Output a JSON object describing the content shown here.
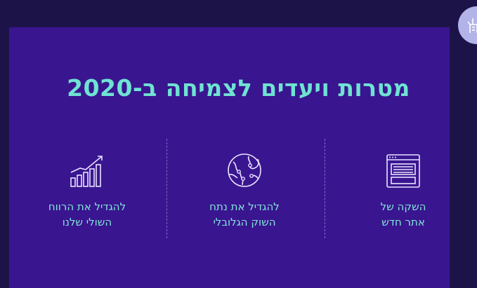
{
  "page": {
    "title": "מטרות ויעדים לצמיחה ב-2020"
  },
  "goals": [
    {
      "icon": "browser-window-icon",
      "line1": "השקה של",
      "line2": "אתר חדש"
    },
    {
      "icon": "globe-icon",
      "line1": "להגדיל את נתח",
      "line2": "השוק הגלובלי"
    },
    {
      "icon": "growth-chart-icon",
      "line1": "להגדיל את הרווח",
      "line2": "השולי שלנו"
    }
  ],
  "colors": {
    "background": "#1c1449",
    "panel": "#3a1590",
    "accent": "#6fe3d2",
    "chip": "#b2b3e8"
  }
}
